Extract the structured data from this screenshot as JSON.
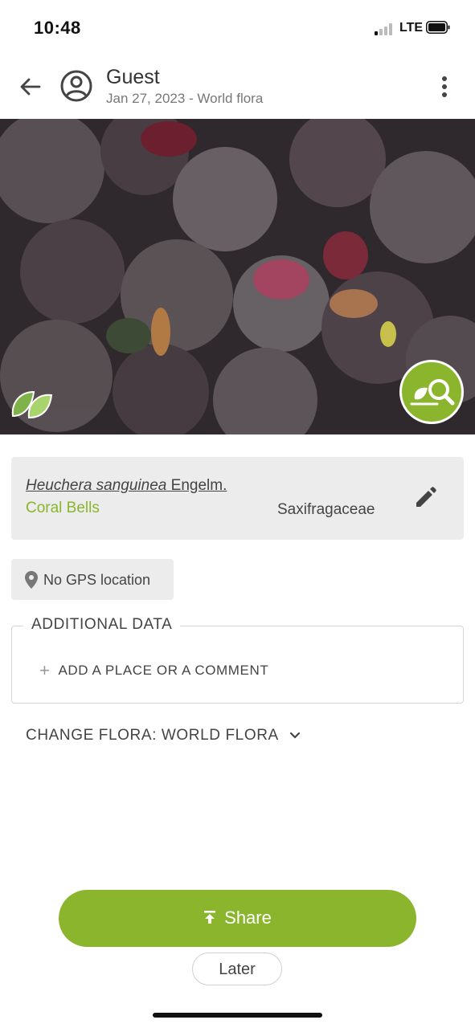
{
  "status_bar": {
    "time": "10:48",
    "network": "LTE",
    "icons": [
      "signal-icon",
      "battery-icon"
    ]
  },
  "header": {
    "title": "Guest",
    "subtitle": "Jan 27, 2023 - World flora",
    "icons": [
      "back-arrow-icon",
      "user-circle-icon",
      "more-vert-icon"
    ]
  },
  "photo": {
    "description_icons": [
      "leaf-badge-icon",
      "identify-search-icon"
    ],
    "accent_color": "#8ab52c"
  },
  "species": {
    "scientific_name": "Heuchera sanguinea",
    "author": "Engelm.",
    "common_name": "Coral Bells",
    "family": "Saxifragaceae"
  },
  "location": {
    "label": "No GPS location"
  },
  "additional_data": {
    "legend": "ADDITIONAL DATA",
    "add_label": "ADD A PLACE OR A COMMENT",
    "add_symbol": "+"
  },
  "flora": {
    "change_label": "CHANGE FLORA: WORLD FLORA"
  },
  "actions": {
    "share_label": "Share",
    "later_label": "Later"
  },
  "colors": {
    "accent": "#8ab52c",
    "card_bg": "#ececec",
    "text": "#444444"
  }
}
